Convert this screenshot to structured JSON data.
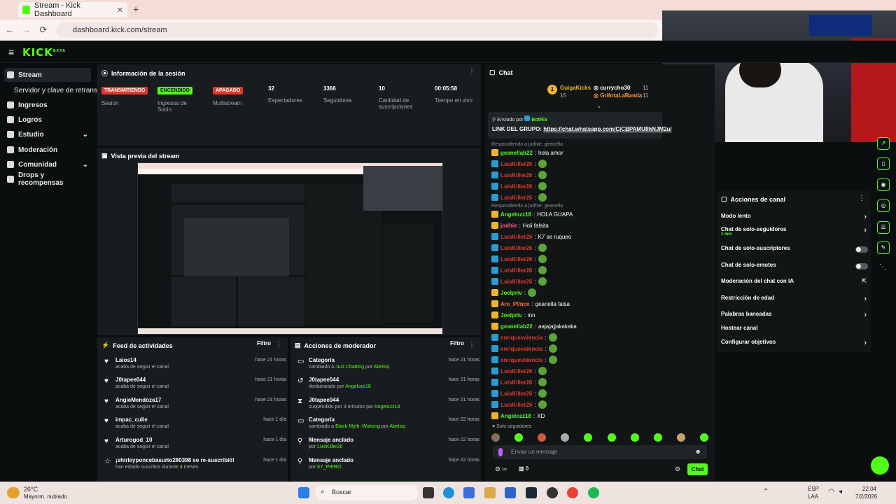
{
  "browser": {
    "tab_title": "Stream - Kick Dashboard",
    "new_tab": "+",
    "url": "dashboard.kick.com/stream",
    "nav": {
      "back": "←",
      "forward": "→",
      "reload": "⟳"
    }
  },
  "app": {
    "logo": "KICK",
    "logo_sup": "BETA",
    "menu_icon": "≡"
  },
  "sidebar": {
    "items": [
      {
        "label": "Stream"
      },
      {
        "label": "Servidor y clave de retransmisión"
      },
      {
        "label": "Ingresos"
      },
      {
        "label": "Logros"
      },
      {
        "label": "Estudio",
        "chevron": "⌄"
      },
      {
        "label": "Moderación"
      },
      {
        "label": "Comunidad",
        "chevron": "⌄"
      },
      {
        "label": "Drops y recompensas"
      }
    ]
  },
  "session": {
    "title": "Información de la sesión",
    "badges": [
      {
        "label": "TRANSMITIENDO",
        "caption": "Sesión",
        "bg": "#e0392f",
        "fg": "#ffffff"
      },
      {
        "label": "ENCENDIDO",
        "caption": "Ingresos de Socio",
        "bg": "#53fc18",
        "fg": "#0b0e0f"
      },
      {
        "label": "APAGADO",
        "caption": "Multistream",
        "bg": "#e0392f",
        "fg": "#ffffff"
      }
    ],
    "stats": [
      {
        "value": "32",
        "label": "Espectadores"
      },
      {
        "value": "3366",
        "label": "Seguidores"
      },
      {
        "value": "10",
        "label": "Cantidad de suscripciones"
      },
      {
        "value": "00:05:58",
        "label": "Tiempo en vivo"
      }
    ]
  },
  "preview": {
    "title": "Vista previa del stream"
  },
  "feed": {
    "title": "Feed de actividades",
    "filter": "Filtro",
    "items": [
      {
        "name": "Laios14",
        "sub": "acaba de seguir el canal",
        "time": "hace 21 horas"
      },
      {
        "name": "J0tapee044",
        "sub": "acaba de seguir el canal",
        "time": "hace 21 horas"
      },
      {
        "name": "AngieMendoza17",
        "sub": "acaba de seguir el canal",
        "time": "hace 23 horas"
      },
      {
        "name": "impac_culie",
        "sub": "acaba de seguir el canal",
        "time": "hace 1 día"
      },
      {
        "name": "Arturogod_10",
        "sub": "acaba de seguir el canal",
        "time": "hace 1 día"
      },
      {
        "name": "¡shirleyponcebasurto280398 se re-suscribió!",
        "sub": "han estado suscritos durante",
        "sub_highlight": "4",
        "sub_tail": " meses",
        "time": "hace 1 día"
      }
    ]
  },
  "modactions": {
    "title": "Acciones de moderador",
    "filter": "Filtro",
    "items": [
      {
        "name": "Categoría",
        "pre": "cambiado a ",
        "hl1": "Just Chatting",
        "mid": " por ",
        "hl2": "Abelssj",
        "time": "hace 21 horas"
      },
      {
        "name": "J0tapee044",
        "pre": "desbaneado por ",
        "hl1": "Angelozz18",
        "mid": "",
        "hl2": "",
        "time": "hace 21 horas"
      },
      {
        "name": "J0tapee044",
        "pre": "suspendido por 3 minutos por ",
        "hl1": "Angelozz18",
        "mid": "",
        "hl2": "",
        "time": "hace 21 horas"
      },
      {
        "name": "Categoría",
        "pre": "cambiado a ",
        "hl1": "Black Myth: Wukong",
        "mid": " por ",
        "hl2": "Abelssj",
        "time": "hace 22 horas"
      },
      {
        "name": "Mensaje anclado",
        "pre": "por ",
        "hl1": "LuisKiller26",
        "mid": "",
        "hl2": "",
        "time": "hace 22 horas"
      },
      {
        "name": "Mensaje anclado",
        "pre": "por ",
        "hl1": "K7_PIERO",
        "mid": "",
        "hl2": "",
        "time": "hace 22 horas"
      }
    ]
  },
  "chat": {
    "title": "Chat",
    "leaderboard": [
      {
        "rank": "1",
        "name": "GuigaKicks",
        "count": "15"
      },
      {
        "name": "currycho30",
        "count": "11"
      },
      {
        "name": "GrifotaLaBanda",
        "count": "11"
      }
    ],
    "pinned": {
      "header": "Enviado por",
      "author": "BotRix",
      "text": "LINK DEL GRUPO:",
      "link": "https://chat.whatsapp.com/CjCBPAMU8hNJM2ul"
    },
    "messages": [
      {
        "reply": "Respondiendo a jodhie: geanella"
      },
      {
        "user": "geanellab22",
        "color": "green",
        "text": "hola amor"
      },
      {
        "user": "LuisKiller26",
        "color": "red",
        "text": "",
        "emote": true
      },
      {
        "user": "LuisKiller26",
        "color": "red",
        "text": "",
        "emote": true
      },
      {
        "user": "LuisKiller26",
        "color": "red",
        "text": "",
        "emote": true
      },
      {
        "user": "LuisKiller26",
        "color": "red",
        "text": "",
        "emote": true
      },
      {
        "reply": "Respondiendo a jodhie: geanella"
      },
      {
        "user": "Angelozz18",
        "color": "green",
        "text": "HOLA GUAPA"
      },
      {
        "user": "jodhie",
        "color": "pink",
        "text": "Hoii falsita"
      },
      {
        "user": "LuisKiller26",
        "color": "red",
        "text": "K7 se ruqueo"
      },
      {
        "user": "LuisKiller26",
        "color": "red",
        "text": "",
        "emote": true
      },
      {
        "user": "LuisKiller26",
        "color": "red",
        "text": "",
        "emote": true
      },
      {
        "user": "LuisKiller26",
        "color": "red",
        "text": "",
        "emote": true
      },
      {
        "user": "LuisKiller26",
        "color": "red",
        "text": "",
        "emote": true
      },
      {
        "user": "Joelpriv",
        "color": "green",
        "text": "",
        "emote": true
      },
      {
        "user": "Are_P0nce",
        "color": "orange",
        "text": "geanella falsa"
      },
      {
        "user": "Joelpriv",
        "color": "green",
        "text": "inn"
      },
      {
        "user": "geanellab22",
        "color": "green",
        "text": "aajajajjakakaka"
      },
      {
        "user": "enriquevalencia",
        "color": "red",
        "text": "",
        "emote": true
      },
      {
        "user": "enriquevalencia",
        "color": "red",
        "text": "",
        "emote": true
      },
      {
        "user": "enriquevalencia",
        "color": "red",
        "text": "",
        "emote": true
      },
      {
        "user": "LuisKiller26",
        "color": "red",
        "text": "",
        "emote": true
      },
      {
        "user": "LuisKiller26",
        "color": "red",
        "text": "",
        "emote": true
      },
      {
        "user": "LuisKiller26",
        "color": "red",
        "text": "",
        "emote": true
      },
      {
        "user": "LuisKiller26",
        "color": "red",
        "text": "",
        "emote": true
      },
      {
        "user": "Angelozz18",
        "color": "green",
        "text": "XD"
      }
    ],
    "followers_only": "Solo seguidores",
    "input_placeholder": "Enviar un mensaje",
    "send_label": "Chat",
    "footer_count": "0",
    "footer_infinity": "∞"
  },
  "channel_actions": {
    "title": "Acciones de canal",
    "items": [
      {
        "label": "Modo lento",
        "type": "chevron"
      },
      {
        "label": "Chat de solo-seguidores",
        "sub": "1 min",
        "type": "chevron"
      },
      {
        "label": "Chat de solo-suscriptores",
        "type": "toggle"
      },
      {
        "label": "Chat de solo-emotes",
        "type": "toggle"
      },
      {
        "label": "Moderación del chat con IA",
        "type": "external"
      },
      {
        "label": "Restricción de edad",
        "type": "chevron"
      },
      {
        "label": "Palabras baneadas",
        "type": "chevron"
      },
      {
        "label": "Hostear canal",
        "type": "none"
      },
      {
        "label": "Configurar objetivos",
        "type": "chevron"
      }
    ]
  },
  "taskbar": {
    "weather_temp": "26°C",
    "weather_desc": "Mayorm. nublado",
    "search": "Buscar",
    "lang_top": "ESP",
    "lang_bottom": "LAA",
    "time": "22:04",
    "date": "7/2/2026"
  },
  "colors": {
    "accent": "#53fc18",
    "danger": "#e0392f",
    "panel": "#181c1e",
    "bg": "#0b0e0f"
  }
}
